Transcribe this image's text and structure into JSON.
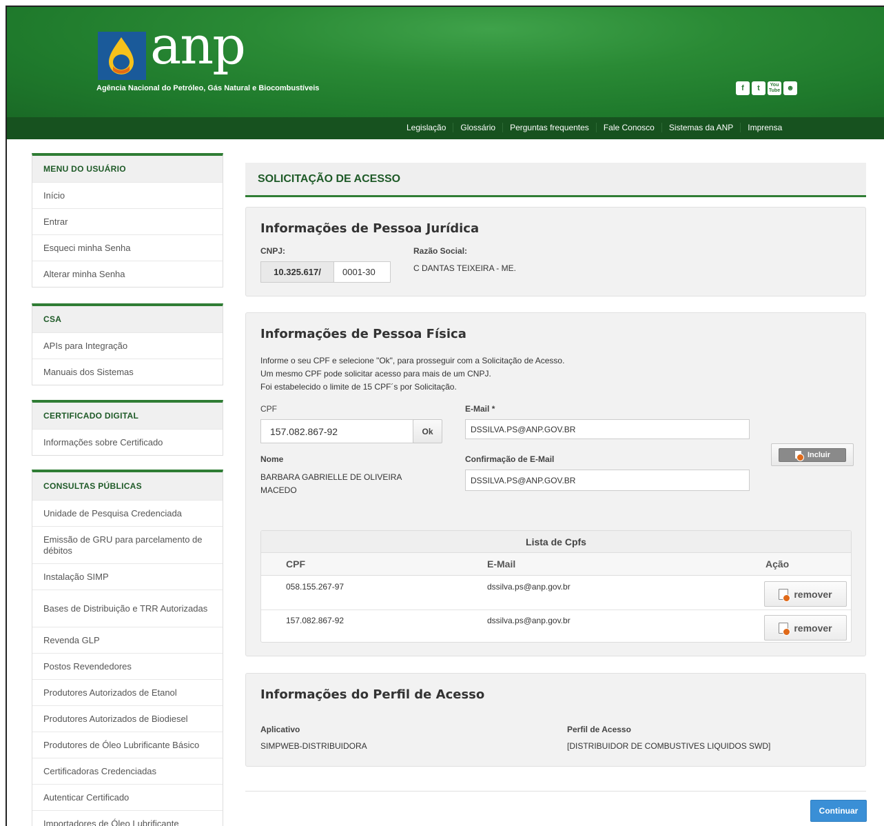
{
  "header": {
    "logo_text": "anp",
    "subtitle": "Agência Nacional do Petróleo, Gás Natural e Biocombustíveis",
    "social": [
      "f",
      "t",
      "You Tube",
      "flickr"
    ],
    "brand_color": "#2a8a35"
  },
  "nav": [
    "Legislação",
    "Glossário",
    "Perguntas frequentes",
    "Fale Conosco",
    "Sistemas da ANP",
    "Imprensa"
  ],
  "sidebar": {
    "menu_usuario": {
      "title": "MENU DO USUÁRIO",
      "items": [
        "Início",
        "Entrar",
        "Esqueci minha Senha",
        "Alterar minha Senha"
      ]
    },
    "csa": {
      "title": "CSA",
      "items": [
        "APIs para Integração",
        "Manuais dos Sistemas"
      ]
    },
    "certificado": {
      "title": "CERTIFICADO DIGITAL",
      "items": [
        "Informações sobre Certificado"
      ]
    },
    "consultas": {
      "title": "CONSULTAS PÚBLICAS",
      "items": [
        "Unidade de Pesquisa Credenciada",
        "Emissão de GRU para parcelamento de débitos",
        "Instalação SIMP",
        "Bases de Distribuição e TRR Autorizadas",
        "Revenda GLP",
        "Postos Revendedores",
        "Produtores Autorizados de Etanol",
        "Produtores Autorizados de Biodiesel",
        "Produtores de Óleo Lubrificante Básico",
        "Certificadoras Credenciadas",
        "Autenticar Certificado",
        "Importadores de Óleo Lubrificante"
      ]
    }
  },
  "page_title": "SOLICITAÇÃO DE ACESSO",
  "pj": {
    "title": "Informações de Pessoa Jurídica",
    "cnpj_label": "CNPJ:",
    "cnpj_prefix": "10.325.617/",
    "cnpj_suffix": "0001-30",
    "razao_label": "Razão Social:",
    "razao_value": "C DANTAS TEIXEIRA - ME."
  },
  "pf": {
    "title": "Informações de Pessoa Física",
    "info_lines": [
      "Informe o seu CPF e selecione \"Ok\", para prosseguir com a Solicitação de Acesso.",
      "Um mesmo CPF pode solicitar acesso para mais de um CNPJ.",
      "Foi estabelecido o limite de 15 CPF´s por Solicitação."
    ],
    "cpf_label": "CPF",
    "cpf_value": "157.082.867-92",
    "ok_label": "Ok",
    "email_label": "E-Mail",
    "required_mark": "*",
    "email_value": "DSSILVA.PS@ANP.GOV.BR",
    "incluir_label": "Incluir",
    "nome_label": "Nome",
    "nome_value": "BARBARA GABRIELLE DE OLIVEIRA MACEDO",
    "confirm_label": "Confirmação de E-Mail",
    "confirm_value": "DSSILVA.PS@ANP.GOV.BR",
    "table": {
      "caption": "Lista de Cpfs",
      "headers": [
        "CPF",
        "E-Mail",
        "Ação"
      ],
      "rows": [
        {
          "cpf": "058.155.267-97",
          "email": "dssilva.ps@anp.gov.br",
          "action": "remover"
        },
        {
          "cpf": "157.082.867-92",
          "email": "dssilva.ps@anp.gov.br",
          "action": "remover"
        }
      ]
    }
  },
  "perfil": {
    "title": "Informações do Perfil de Acesso",
    "app_label": "Aplicativo",
    "app_value": "SIMPWEB-DISTRIBUIDORA",
    "perfil_label": "Perfil de Acesso",
    "perfil_value": "[DISTRIBUIDOR DE COMBUSTIVES LIQUIDOS SWD]"
  },
  "continuar_label": "Continuar"
}
